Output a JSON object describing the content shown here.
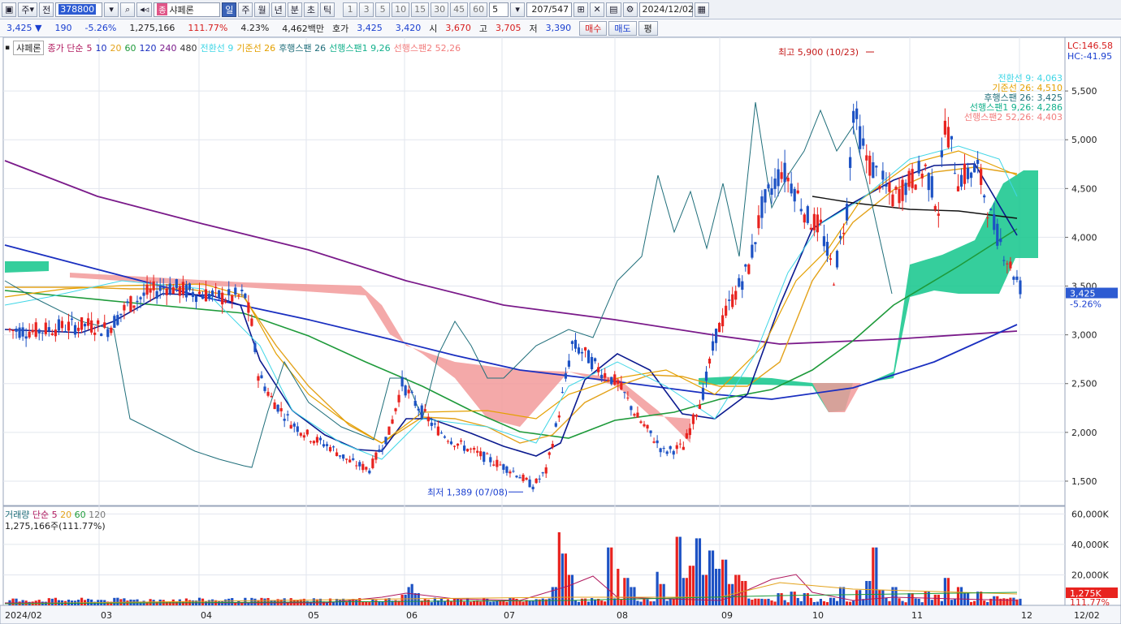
{
  "toolbar": {
    "market": "주",
    "kind": "전",
    "code": "378800",
    "name_badge": "종",
    "name": "샤페론",
    "periods": [
      "일",
      "주",
      "월",
      "년",
      "분",
      "초",
      "틱"
    ],
    "selected_period": "일",
    "intervals": [
      "1",
      "3",
      "5",
      "10",
      "15",
      "30",
      "45",
      "60"
    ],
    "interval_value": "5",
    "count": "207",
    "total": "/547",
    "date": "2024/12/02"
  },
  "info": {
    "price": "3,425",
    "arrow": "▼",
    "change": "190",
    "change_pct": "-5.26%",
    "volume": "1,275,166",
    "vol_ratio": "111.77%",
    "turnover": "4.23%",
    "amount": "4,462백만",
    "hoga_label": "호가",
    "ask": "3,425",
    "bid": "3,420",
    "open_label": "시",
    "open": "3,670",
    "high_label": "고",
    "high": "3,705",
    "low_label": "저",
    "low": "3,390",
    "buy_label": "매수",
    "sell_label": "매도",
    "eval_label": "평"
  },
  "legend": {
    "name": "샤페론",
    "ma_label": "종가 단순",
    "ma": [
      "5",
      "10",
      "20",
      "60",
      "120",
      "240",
      "480"
    ],
    "ichimoku": [
      "전환선 9",
      "기준선 26",
      "후행스팬 26",
      "선행스팬1 9,26",
      "선행스팬2 52,26"
    ]
  },
  "right_labels": {
    "lc": "LC:146.58",
    "hc": "HC:-41.95",
    "ich": [
      "전환선 9: 4,063",
      "기준선 26: 4,510",
      "후행스팬 26: 3,425",
      "선행스팬1 9,26: 4,286",
      "선행스팬2 52,26: 4,403"
    ],
    "price_tag": "3,425",
    "pct_tag": "-5.26%",
    "vol_tag": "1,275K",
    "vol_pct_tag": "111.77%"
  },
  "annotations": {
    "high": "최고 5,900 (10/23)",
    "low": "최저 1,389 (07/08)"
  },
  "volume_legend": {
    "label": "거래량",
    "ma_label": "단순",
    "ma": [
      "5",
      "20",
      "60",
      "120"
    ],
    "value": "1,275,166주(111.77%)"
  },
  "colors": {
    "up": "#e8231f",
    "down": "#1d52c4",
    "ma5": "#0b1a8f",
    "ma20": "#e3a21a",
    "ma60": "#1e9a3a",
    "ma120": "#1a2fc0",
    "ma240": "#7a1a8a",
    "cloud_up": "#12c58b",
    "cloud_down": "#f29a9a",
    "tenkan": "#3fd6e6",
    "kijun": "#e4a000",
    "chikou": "#1f6e7a"
  },
  "chart_data": {
    "type": "candlestick",
    "price_ticks": [
      "5,500",
      "5,000",
      "4,500",
      "4,000",
      "3,500",
      "3,000",
      "2,500",
      "2,000",
      "1,500"
    ],
    "volume_ticks": [
      "60,000K",
      "40,000K",
      "20,000K"
    ],
    "x_labels": [
      "2024/02",
      "03",
      "04",
      "05",
      "06",
      "07",
      "08",
      "09",
      "10",
      "11",
      "12",
      "12/02"
    ],
    "ylim": [
      1250,
      6050
    ],
    "ma_last": {
      "ma5": 4063,
      "ma20": 4510,
      "ma60": 4100,
      "ma120": 3100,
      "ma240": 3020
    },
    "price_path": [
      [
        0,
        3050
      ],
      [
        8,
        3040
      ],
      [
        16,
        3080
      ],
      [
        24,
        3100
      ],
      [
        30,
        3060
      ],
      [
        36,
        3300
      ],
      [
        42,
        3420
      ],
      [
        48,
        3500
      ],
      [
        54,
        3450
      ],
      [
        60,
        3420
      ],
      [
        66,
        3380
      ],
      [
        72,
        3400
      ],
      [
        74,
        3100
      ],
      [
        76,
        2600
      ],
      [
        80,
        2350
      ],
      [
        86,
        2100
      ],
      [
        92,
        1950
      ],
      [
        98,
        1850
      ],
      [
        104,
        1700
      ],
      [
        110,
        1620
      ],
      [
        116,
        2000
      ],
      [
        120,
        2500
      ],
      [
        124,
        2300
      ],
      [
        130,
        2050
      ],
      [
        136,
        1900
      ],
      [
        142,
        1800
      ],
      [
        148,
        1700
      ],
      [
        154,
        1600
      ],
      [
        160,
        1450
      ],
      [
        164,
        1600
      ],
      [
        168,
        2200
      ],
      [
        172,
        2900
      ],
      [
        176,
        2800
      ],
      [
        180,
        2650
      ],
      [
        186,
        2500
      ],
      [
        192,
        2150
      ],
      [
        196,
        1980
      ],
      [
        200,
        1800
      ],
      [
        206,
        1850
      ],
      [
        212,
        2400
      ],
      [
        216,
        3000
      ],
      [
        220,
        3300
      ],
      [
        226,
        3700
      ],
      [
        230,
        4300
      ],
      [
        236,
        4700
      ],
      [
        240,
        4500
      ],
      [
        244,
        4200
      ],
      [
        248,
        4100
      ],
      [
        252,
        3600
      ],
      [
        256,
        4300
      ],
      [
        258,
        5300
      ],
      [
        262,
        4800
      ],
      [
        266,
        4600
      ],
      [
        270,
        4400
      ],
      [
        276,
        4600
      ],
      [
        280,
        4700
      ],
      [
        284,
        4300
      ],
      [
        286,
        5200
      ],
      [
        290,
        4600
      ],
      [
        296,
        4700
      ],
      [
        300,
        4200
      ],
      [
        306,
        3700
      ],
      [
        310,
        3425
      ]
    ],
    "volume_bars": [
      [
        195,
        7000
      ],
      [
        197,
        12000
      ],
      [
        199,
        14000
      ],
      [
        201,
        8000
      ],
      [
        268,
        12000
      ],
      [
        272,
        48000
      ],
      [
        274,
        34000
      ],
      [
        276,
        20000
      ],
      [
        296,
        38000
      ],
      [
        300,
        24000
      ],
      [
        304,
        18000
      ],
      [
        308,
        12000
      ],
      [
        320,
        22000
      ],
      [
        322,
        14000
      ],
      [
        330,
        45000
      ],
      [
        333,
        18000
      ],
      [
        336,
        26000
      ],
      [
        340,
        44000
      ],
      [
        343,
        20000
      ],
      [
        346,
        36000
      ],
      [
        349,
        24000
      ],
      [
        352,
        30000
      ],
      [
        355,
        14000
      ],
      [
        359,
        20000
      ],
      [
        362,
        16000
      ],
      [
        380,
        8000
      ],
      [
        386,
        9000
      ],
      [
        392,
        8000
      ],
      [
        410,
        12000
      ],
      [
        418,
        10000
      ],
      [
        424,
        16000
      ],
      [
        426,
        38000
      ],
      [
        430,
        10000
      ],
      [
        436,
        12000
      ],
      [
        444,
        8000
      ],
      [
        452,
        9000
      ],
      [
        458,
        7000
      ],
      [
        462,
        18000
      ],
      [
        468,
        12000
      ],
      [
        472,
        8000
      ],
      [
        478,
        9000
      ],
      [
        486,
        6000
      ],
      [
        494,
        5000
      ],
      [
        500,
        4000
      ]
    ]
  }
}
